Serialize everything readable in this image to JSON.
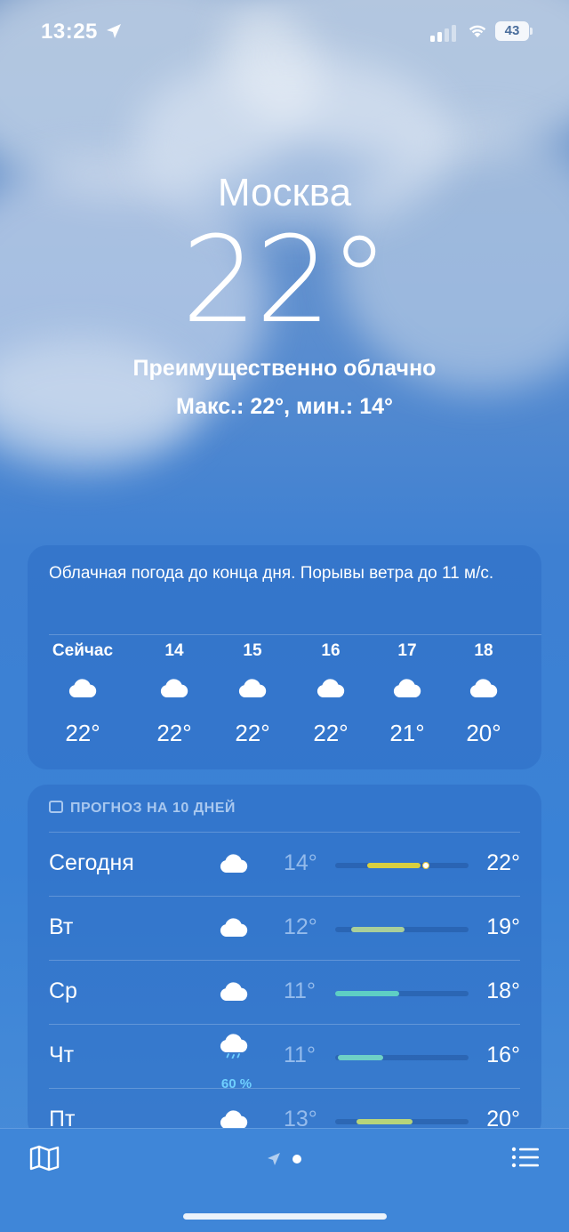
{
  "status_bar": {
    "time": "13:25",
    "battery": "43"
  },
  "hero": {
    "city": "Москва",
    "temperature": "22°",
    "condition": "Преимущественно облачно",
    "high_low": "Макс.: 22°, мин.: 14°"
  },
  "hourly": {
    "summary": "Облачная погода до конца дня. Порывы ветра до 11 м/с.",
    "items": [
      {
        "label": "Сейчас",
        "icon": "cloud-icon",
        "temp": "22°"
      },
      {
        "label": "14",
        "icon": "cloud-icon",
        "temp": "22°"
      },
      {
        "label": "15",
        "icon": "cloud-icon",
        "temp": "22°"
      },
      {
        "label": "16",
        "icon": "cloud-icon",
        "temp": "22°"
      },
      {
        "label": "17",
        "icon": "cloud-icon",
        "temp": "21°"
      },
      {
        "label": "18",
        "icon": "cloud-icon",
        "temp": "20°"
      }
    ]
  },
  "daily": {
    "header": "ПРОГНОЗ НА 10 ДНЕЙ",
    "days": [
      {
        "name": "Сегодня",
        "icon": "cloud-icon",
        "precip": "",
        "low": "14°",
        "high": "22°",
        "range_start": 0.24,
        "range_end": 0.64,
        "current": 0.68,
        "color": "#d9cf3f"
      },
      {
        "name": "Вт",
        "icon": "cloud-icon",
        "precip": "",
        "low": "12°",
        "high": "19°",
        "range_start": 0.12,
        "range_end": 0.52,
        "color": "#a9cf9a"
      },
      {
        "name": "Ср",
        "icon": "cloud-icon",
        "precip": "",
        "low": "11°",
        "high": "18°",
        "range_start": 0.0,
        "range_end": 0.48,
        "color": "#5ecfc4"
      },
      {
        "name": "Чт",
        "icon": "cloud-rain-icon",
        "precip": "60 %",
        "low": "11°",
        "high": "16°",
        "range_start": 0.02,
        "range_end": 0.36,
        "color": "#6ed0c6"
      },
      {
        "name": "Пт",
        "icon": "cloud-icon",
        "precip": "",
        "low": "13°",
        "high": "20°",
        "range_start": 0.16,
        "range_end": 0.58,
        "color": "#b7d47a"
      }
    ]
  },
  "bottom_bar": {
    "map_icon": "map-icon",
    "list_icon": "list-icon"
  },
  "colors": {
    "accent_blue": "#3a82d6",
    "precip_text": "#6fd0ff"
  }
}
